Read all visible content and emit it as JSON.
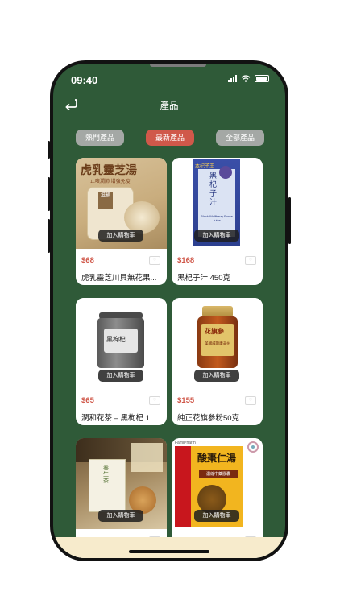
{
  "status_bar": {
    "time": "09:40"
  },
  "header": {
    "title": "產品"
  },
  "tabs": [
    {
      "label": "熱門產品",
      "active": false
    },
    {
      "label": "最新產品",
      "active": true
    },
    {
      "label": "全部產品",
      "active": false
    }
  ],
  "products": [
    {
      "price": "$68",
      "name": "虎乳靈芝川貝無花果...",
      "cart_label": "加入購物車",
      "image_title": "虎乳靈芝湯",
      "image_subtitle": "止咳潤肺 增強免疫",
      "image_tag": "滋補",
      "image_alt": "Soup herbs package"
    },
    {
      "price": "$168",
      "name": "黑杞子汁 450克",
      "cart_label": "加入購物車",
      "image_title": "黑杞子汁",
      "image_brand": "本杞子王",
      "image_subtitle": "Black Wolfberry Puree Juice",
      "image_alt": "Black wolfberry juice box"
    },
    {
      "price": "$65",
      "name": "潤和花茶 – 黑枸杞 1...",
      "cart_label": "加入購物車",
      "image_title": "黑枸杞",
      "image_alt": "Jar of black goji tea"
    },
    {
      "price": "$155",
      "name": "純正花旗參粉50克",
      "cart_label": "加入購物車",
      "image_title": "花旗參",
      "image_subtitle": "美國威斯康辛州",
      "image_alt": "Bottle of American ginseng powder"
    },
    {
      "price": "",
      "name": "",
      "cart_label": "加入購物車",
      "image_title": "養生茶",
      "image_alt": "Herbal tea box"
    },
    {
      "price": "",
      "name": "",
      "cart_label": "加入購物車",
      "image_title": "酸棗仁湯",
      "image_brand": "FamiPharm",
      "image_subtitle": "濃縮中藥膠囊",
      "image_alt": "Suanzaoren decoction box"
    }
  ],
  "colors": {
    "background": "#2f5a38",
    "accent": "#d0584a",
    "tab_inactive": "#a4a8a5",
    "bottom_bar": "#f7ebcc"
  },
  "icons": {
    "back": "back-arrow-icon",
    "wishlist": "wishlist-icon"
  }
}
